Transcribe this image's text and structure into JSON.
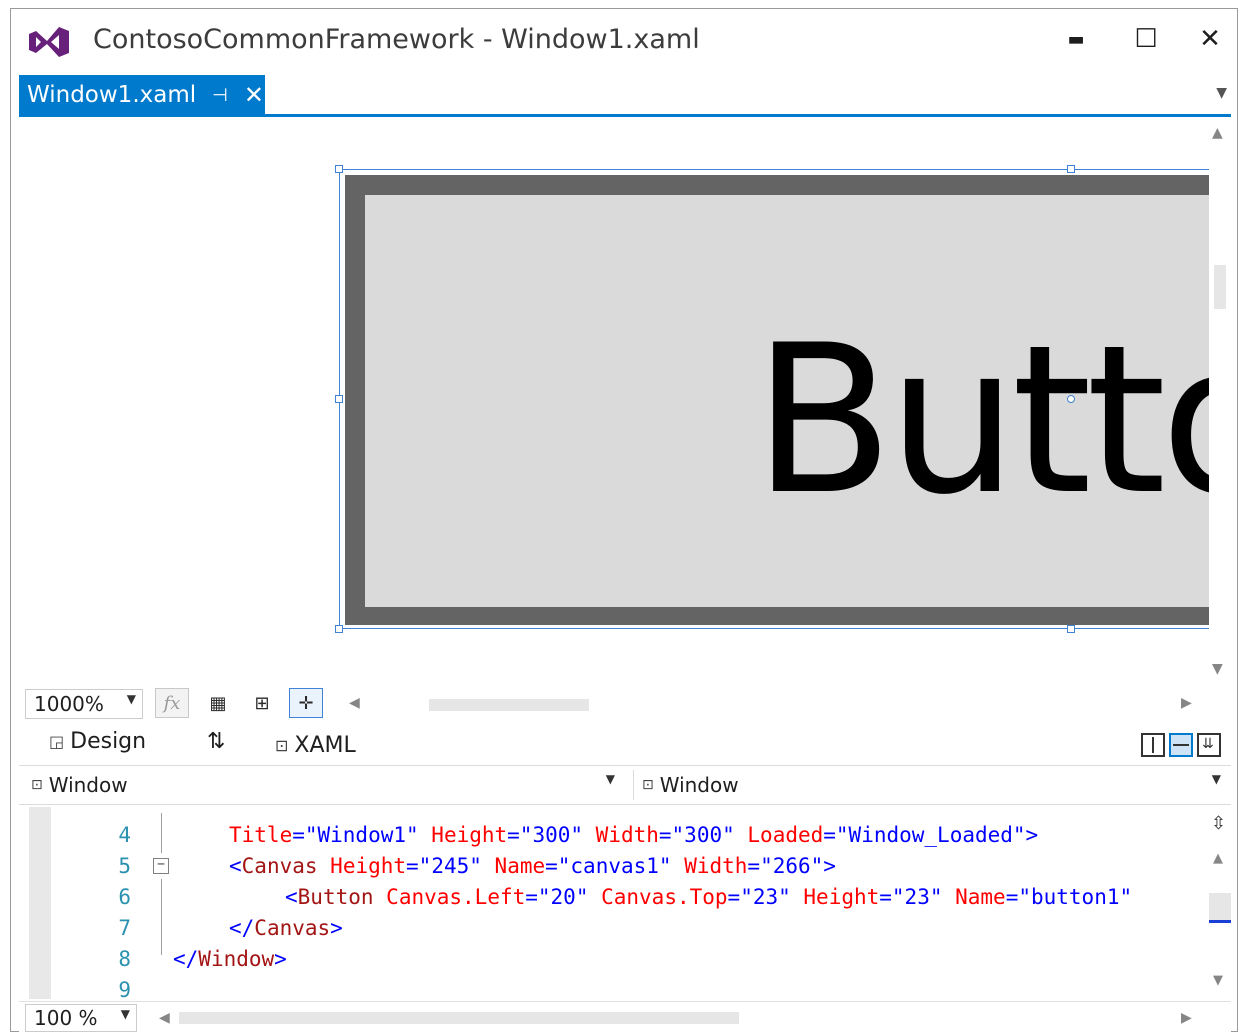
{
  "window": {
    "title": "ContosoCommonFramework - Window1.xaml",
    "controls": {
      "minimize": "▬",
      "maximize": "☐",
      "close": "✕"
    }
  },
  "tabs": [
    {
      "label": "Window1.xaml",
      "pin_icon": "pin-icon",
      "close_icon": "close-icon",
      "active": true
    }
  ],
  "designer": {
    "button_text": "Butto"
  },
  "zoom_bar": {
    "zoom": "1000%",
    "fx_label": "fx"
  },
  "view_tabs": {
    "design_label": "Design",
    "swap_label": "⇅",
    "xaml_label": "XAML"
  },
  "breadcrumbs": {
    "left": "Window",
    "right": "Window"
  },
  "code": {
    "lines": [
      {
        "num": "4",
        "tokens": [
          [
            "c-attr",
            "Title"
          ],
          [
            "c-punct",
            "=\"Window1\" "
          ],
          [
            "c-attr",
            "Height"
          ],
          [
            "c-punct",
            "=\"300\" "
          ],
          [
            "c-attr",
            "Width"
          ],
          [
            "c-punct",
            "=\"300\" "
          ],
          [
            "c-attr",
            "Loaded"
          ],
          [
            "c-punct",
            "=\"Window_Loaded\">"
          ]
        ]
      },
      {
        "num": "5",
        "tokens": [
          [
            "c-punct",
            "<"
          ],
          [
            "c-tag",
            "Canvas"
          ],
          [
            "c-punct",
            " "
          ],
          [
            "c-attr",
            "Height"
          ],
          [
            "c-punct",
            "=\"245\" "
          ],
          [
            "c-attr",
            "Name"
          ],
          [
            "c-punct",
            "=\"canvas1\" "
          ],
          [
            "c-attr",
            "Width"
          ],
          [
            "c-punct",
            "=\"266\">"
          ]
        ]
      },
      {
        "num": "6",
        "tokens": [
          [
            "c-punct",
            "<"
          ],
          [
            "c-tag",
            "Button"
          ],
          [
            "c-punct",
            " "
          ],
          [
            "c-attr",
            "Canvas.Left"
          ],
          [
            "c-punct",
            "=\"20\" "
          ],
          [
            "c-attr",
            "Canvas.Top"
          ],
          [
            "c-punct",
            "=\"23\" "
          ],
          [
            "c-attr",
            "Height"
          ],
          [
            "c-punct",
            "=\"23\" "
          ],
          [
            "c-attr",
            "Name"
          ],
          [
            "c-punct",
            "=\"button1\""
          ]
        ]
      },
      {
        "num": "7",
        "tokens": [
          [
            "c-punct",
            "</"
          ],
          [
            "c-tag",
            "Canvas"
          ],
          [
            "c-punct",
            ">"
          ]
        ]
      },
      {
        "num": "8",
        "tokens": [
          [
            "c-punct",
            "</"
          ],
          [
            "c-tag",
            "Window"
          ],
          [
            "c-punct",
            ">"
          ]
        ]
      },
      {
        "num": "9",
        "tokens": []
      }
    ]
  },
  "status": {
    "zoom": "100 %"
  },
  "colors": {
    "accent": "#007acc",
    "vs_purple": "#68217a",
    "button_border": "#646464",
    "button_face": "#dadada"
  }
}
